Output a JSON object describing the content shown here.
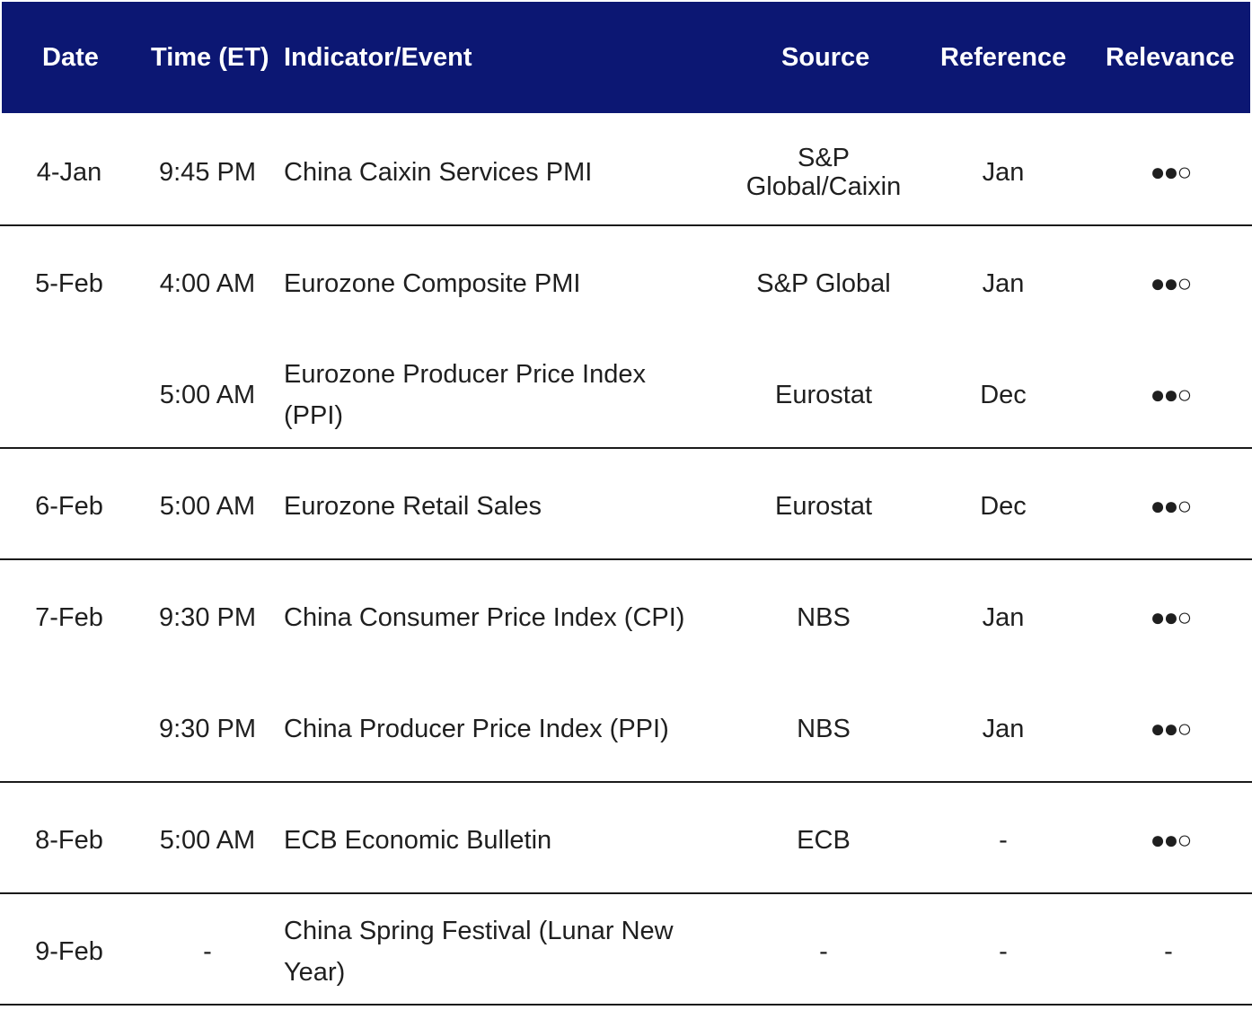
{
  "headers": {
    "date": "Date",
    "time": "Time (ET)",
    "event": "Indicator/Event",
    "source": "Source",
    "reference": "Reference",
    "relevance": "Relevance"
  },
  "rows": [
    {
      "date": "4-Jan",
      "time": "9:45 PM",
      "event": "China Caixin Services PMI",
      "source": "S&P Global/Caixin",
      "reference": "Jan",
      "relevance": "●●○"
    },
    {
      "date": "5-Feb",
      "time": "4:00 AM",
      "event": "Eurozone Composite PMI",
      "source": "S&P Global",
      "reference": "Jan",
      "relevance": "●●○"
    },
    {
      "date": "",
      "time": "5:00 AM",
      "event": "Eurozone Producer Price Index (PPI)",
      "source": "Eurostat",
      "reference": "Dec",
      "relevance": "●●○"
    },
    {
      "date": "6-Feb",
      "time": "5:00 AM",
      "event": "Eurozone Retail Sales",
      "source": "Eurostat",
      "reference": "Dec",
      "relevance": "●●○"
    },
    {
      "date": "7-Feb",
      "time": "9:30 PM",
      "event": "China Consumer Price Index (CPI)",
      "source": "NBS",
      "reference": "Jan",
      "relevance": "●●○"
    },
    {
      "date": "",
      "time": "9:30 PM",
      "event": "China Producer Price Index (PPI)",
      "source": "NBS",
      "reference": "Jan",
      "relevance": "●●○"
    },
    {
      "date": "8-Feb",
      "time": "5:00 AM",
      "event": "ECB Economic Bulletin",
      "source": "ECB",
      "reference": "-",
      "relevance": "●●○"
    },
    {
      "date": "9-Feb",
      "time": "-",
      "event": "China Spring Festival (Lunar New Year)",
      "source": "-",
      "reference": "-",
      "relevance": "-"
    }
  ],
  "colors": {
    "header_bg": "#0c1773",
    "header_text": "#ffffff",
    "body_text": "#1f1f1f",
    "divider": "#1a1a1a"
  }
}
